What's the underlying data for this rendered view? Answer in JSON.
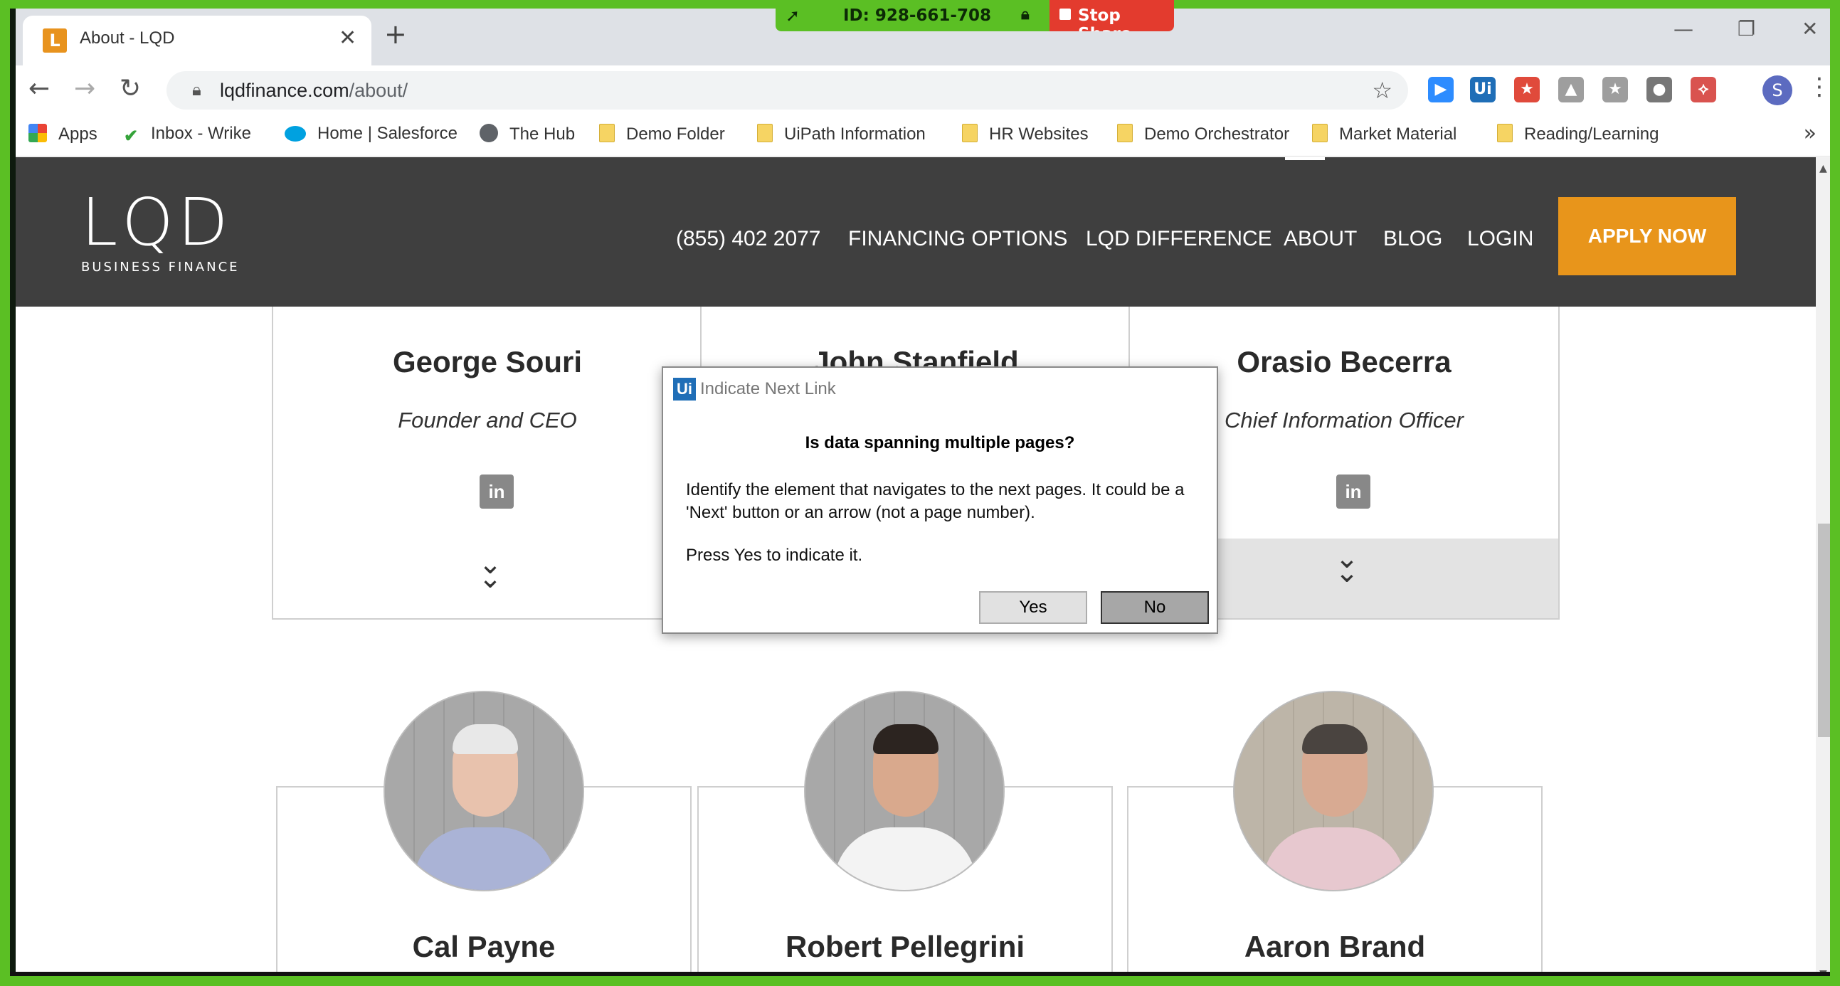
{
  "share": {
    "id_label": "ID: 928-661-708",
    "stop_label": "Stop Share"
  },
  "tab": {
    "title": "About - LQD",
    "favicon_letter": "L"
  },
  "address": {
    "host": "lqdfinance.com",
    "path": "/about/"
  },
  "extensions": [
    {
      "name": "zoom",
      "color": "#2d8cff",
      "glyph": "▶"
    },
    {
      "name": "uipath",
      "color": "#1f6eb7",
      "glyph": "Ui"
    },
    {
      "name": "wrike",
      "color": "#e04a3b",
      "glyph": "★"
    },
    {
      "name": "drive",
      "color": "#9e9e9e",
      "glyph": "▲"
    },
    {
      "name": "bookmark-ext",
      "color": "#9e9e9e",
      "glyph": "★"
    },
    {
      "name": "circle-ext",
      "color": "#777",
      "glyph": "●"
    },
    {
      "name": "pdf",
      "color": "#d9534f",
      "glyph": "⟡"
    }
  ],
  "avatar_letter": "S",
  "bookmarks": [
    {
      "label": "Apps"
    },
    {
      "label": "Inbox - Wrike"
    },
    {
      "label": "Home | Salesforce"
    },
    {
      "label": "The Hub"
    },
    {
      "label": "Demo Folder"
    },
    {
      "label": "UiPath Information"
    },
    {
      "label": "HR Websites"
    },
    {
      "label": "Demo Orchestrator"
    },
    {
      "label": "Market Material"
    },
    {
      "label": "Reading/Learning"
    }
  ],
  "site": {
    "logo_main": "LQD",
    "logo_sub": "BUSINESS FINANCE",
    "nav": [
      "(855) 402 2077",
      "FINANCING OPTIONS",
      "LQD DIFFERENCE",
      "ABOUT",
      "BLOG",
      "LOGIN"
    ],
    "apply": "APPLY NOW"
  },
  "team_top": [
    {
      "name": "George Souri",
      "role": "Founder and CEO"
    },
    {
      "name": "John Stanfield",
      "role": ""
    },
    {
      "name": "Orasio Becerra",
      "role": "Chief Information Officer"
    }
  ],
  "team_bottom": [
    {
      "name": "Cal Payne"
    },
    {
      "name": "Robert Pellegrini"
    },
    {
      "name": "Aaron Brand"
    }
  ],
  "linkedin_glyph": "in",
  "dialog": {
    "title": "Indicate Next Link",
    "icon": "Ui",
    "question": "Is data spanning multiple pages?",
    "body": "Identify the element that navigates to the next pages. It could be a 'Next' button or an arrow (not a page number).",
    "body2": "Press Yes to indicate it.",
    "yes": "Yes",
    "no": "No"
  }
}
